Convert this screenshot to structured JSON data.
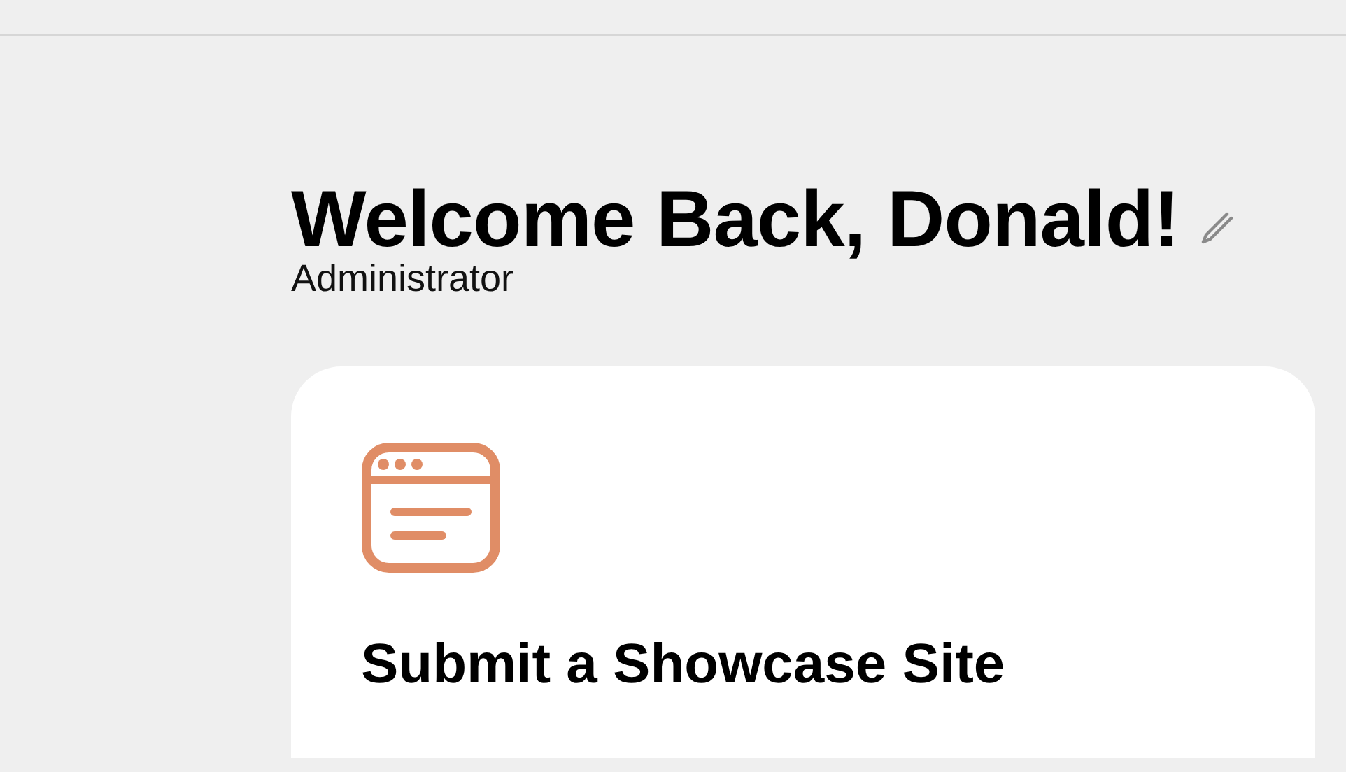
{
  "greeting": {
    "title": "Welcome Back, Donald!",
    "role": "Administrator"
  },
  "card": {
    "title": "Submit a Showcase Site"
  }
}
